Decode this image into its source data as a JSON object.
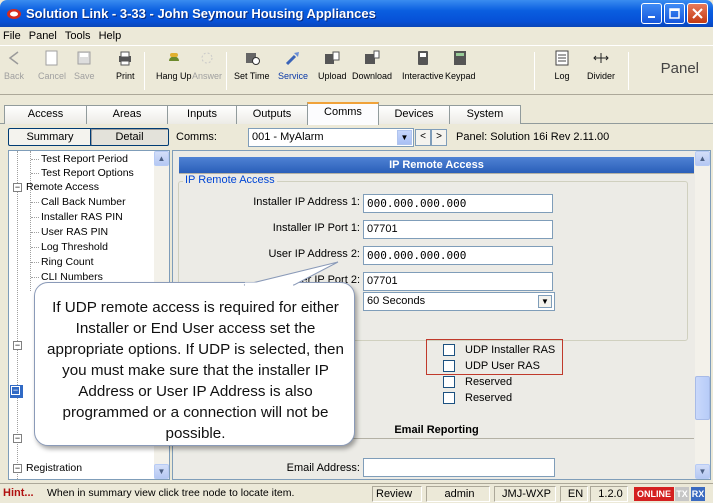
{
  "window": {
    "title": "Solution Link - 3-33 - John Seymour Housing Appliances"
  },
  "menu": [
    "File",
    "Panel",
    "Tools",
    "Help"
  ],
  "toolbar": {
    "buttons": [
      {
        "label": "Back",
        "icon": "back-arrow-icon",
        "enabled": false
      },
      {
        "label": "Cancel",
        "icon": "cancel-doc-icon",
        "enabled": false
      },
      {
        "label": "Save",
        "icon": "save-disk-icon",
        "enabled": false
      },
      {
        "label": "Print",
        "icon": "printer-icon",
        "enabled": true
      },
      {
        "label": "Hang Up",
        "icon": "hang-up-phone-icon",
        "enabled": true
      },
      {
        "label": "Answer",
        "icon": "answer-phone-icon",
        "enabled": false
      },
      {
        "label": "Set Time",
        "icon": "clock-icon",
        "enabled": true
      },
      {
        "label": "Service",
        "icon": "service-tool-icon",
        "enabled": true,
        "active": true
      },
      {
        "label": "Upload",
        "icon": "upload-icon",
        "enabled": true
      },
      {
        "label": "Download",
        "icon": "download-icon",
        "enabled": true
      },
      {
        "label": "Interactive",
        "icon": "interactive-icon",
        "enabled": true
      },
      {
        "label": "Keypad",
        "icon": "keypad-icon",
        "enabled": true
      },
      {
        "label": "Log",
        "icon": "log-icon",
        "enabled": true
      },
      {
        "label": "Divider",
        "icon": "divider-icon",
        "enabled": true
      }
    ],
    "panel_label": "Panel"
  },
  "tabs": [
    "Access",
    "Areas",
    "Inputs",
    "Outputs",
    "Comms",
    "Devices",
    "System"
  ],
  "active_tab": "Comms",
  "subbar": {
    "summary": "Summary",
    "detail": "Detail",
    "comms_label": "Comms:",
    "comms_value": "001 - MyAlarm",
    "prev": "<",
    "next": ">",
    "panel_info": "Panel:  Solution 16i Rev 2.11.00"
  },
  "tree": {
    "items": [
      {
        "label": "Test Report Period",
        "level": 2
      },
      {
        "label": "Test Report Options",
        "level": 2
      },
      {
        "label": "Remote Access",
        "level": 1,
        "expander": "-"
      },
      {
        "label": "Call Back Number",
        "level": 2
      },
      {
        "label": "Installer RAS PIN",
        "level": 2
      },
      {
        "label": "User RAS PIN",
        "level": 2
      },
      {
        "label": "Log Threshold",
        "level": 2
      },
      {
        "label": "Ring Count",
        "level": 2
      },
      {
        "label": "CLI Numbers",
        "level": 2
      },
      {
        "label": "Registration",
        "level": 1,
        "expander": "-"
      }
    ]
  },
  "ip_remote_access": {
    "header": "IP Remote Access",
    "group_label": "IP Remote Access",
    "installer_ip_label": "Installer IP Address 1:",
    "installer_ip_value": "000.000.000.000",
    "installer_port_label": "Installer IP Port 1:",
    "installer_port_value": "07701",
    "user_ip_label": "User IP Address 2:",
    "user_ip_value": "000.000.000.000",
    "user_port_label": "User IP Port 2:",
    "user_port_value": "07701",
    "timeout_value": "60 Seconds",
    "options": [
      {
        "label": "UDP Installer RAS",
        "checked": false
      },
      {
        "label": "UDP User RAS",
        "checked": false
      },
      {
        "label": "Reserved",
        "checked": false
      },
      {
        "label": "Reserved",
        "checked": false
      }
    ]
  },
  "email_reporting": {
    "header": "Email Reporting",
    "email_label": "Email Address:",
    "email_value": ""
  },
  "callout": {
    "text": "If UDP remote access is required for either Installer or End User access set the appropriate options.  If UDP is selected, then you must make sure that the installer IP Address or User IP Address is also programmed or a connection will not be possible."
  },
  "status": {
    "hint_prefix": "Hint...",
    "hint": "When in summary view click tree node to locate item.",
    "review": "Review",
    "user": "admin",
    "machine": "JMJ-WXP",
    "lang": "EN",
    "version": "1.2.0",
    "online": "ONLINE",
    "tx": "TX",
    "rx": "RX"
  },
  "colors": {
    "titlebar": "#0a5ee0",
    "section_header": "#2a5fb9",
    "highlight_box": "#c0392b",
    "online_badge": "#d42020"
  }
}
